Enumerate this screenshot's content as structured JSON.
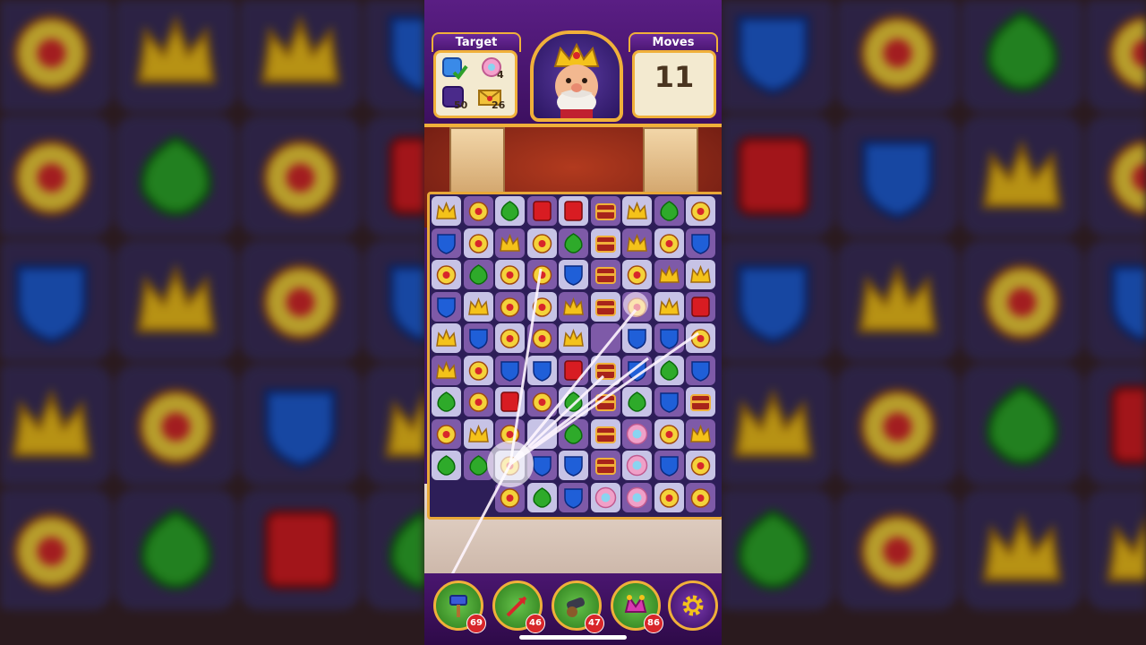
{
  "hud": {
    "target_label": "Target",
    "moves_label": "Moves",
    "moves_left": "11",
    "targets": [
      {
        "icon": "blue-tile-icon",
        "count": "",
        "done": true
      },
      {
        "icon": "pink-flower-icon",
        "count": "4"
      },
      {
        "icon": "purple-tile-icon",
        "count": "50"
      },
      {
        "icon": "envelope-icon",
        "count": "26"
      }
    ]
  },
  "boosters": [
    {
      "icon": "hammer-icon",
      "count": "69"
    },
    {
      "icon": "arrow-icon",
      "count": "46"
    },
    {
      "icon": "cannon-icon",
      "count": "47"
    },
    {
      "icon": "jester-hat-icon",
      "count": "86"
    }
  ],
  "settings_icon": "gear-icon",
  "colors": {
    "gold": "#f0b03a",
    "purple": "#5a1e84",
    "crown": "#f4c21a",
    "shield": "#1f5fd8",
    "leaf": "#2eaa2a",
    "red": "#d81c22",
    "pink": "#f0a0c8"
  }
}
